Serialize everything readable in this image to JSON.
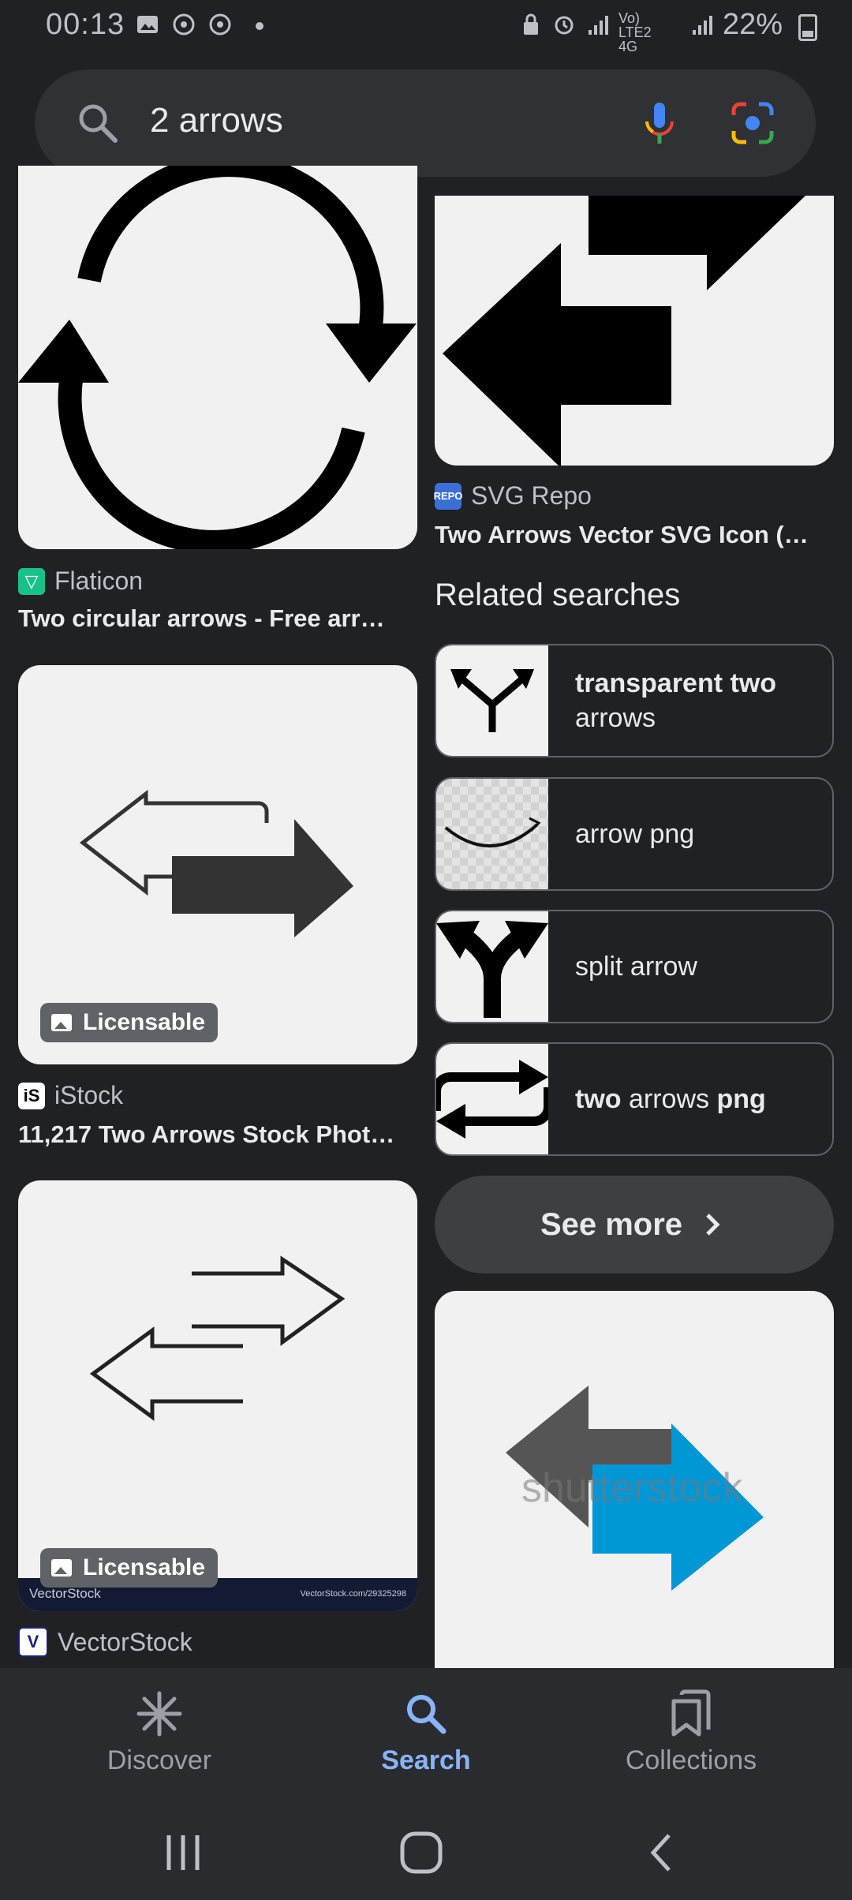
{
  "status_bar": {
    "time": "00:13",
    "battery": "22%",
    "signal_text": "Vo) LTE2 4G"
  },
  "search": {
    "query": "2 arrows"
  },
  "results": {
    "left": [
      {
        "source": "Flaticon",
        "title": "Two circular arrows - Free arro..."
      },
      {
        "source": "iStock",
        "title": "11,217 Two Arrows Stock Photo...",
        "badge": "Licensable"
      },
      {
        "source": "VectorStock",
        "title": "",
        "badge": "Licensable",
        "watermark_left": "VectorStock",
        "watermark_right": "VectorStock.com/29325298"
      }
    ],
    "right": [
      {
        "source": "SVG Repo",
        "title": "Two Arrows Vector SVG Icon (2)...",
        "favicon_text": "REPO"
      },
      {
        "watermark": "shutterstock"
      }
    ]
  },
  "related": {
    "title": "Related searches",
    "items": [
      {
        "bold": "transparent two",
        "normal": "arrows",
        "thumb_icon": "fork-arrow-icon"
      },
      {
        "bold": "",
        "normal": "arrow png",
        "thumb_icon": "smile-arrow-icon"
      },
      {
        "bold": "",
        "normal": "split arrow",
        "thumb_icon": "split-arrow-icon"
      },
      {
        "pre": "two",
        "normal": "arrows",
        "post": "png",
        "thumb_icon": "repeat-arrows-icon"
      }
    ],
    "see_more": "See more"
  },
  "bottom_nav": {
    "items": [
      {
        "label": "Discover",
        "icon": "asterisk-icon"
      },
      {
        "label": "Search",
        "icon": "search-icon",
        "active": true
      },
      {
        "label": "Collections",
        "icon": "collections-icon"
      }
    ]
  },
  "colors": {
    "background": "#202124",
    "active": "#8ab4f8",
    "shutterstock_blue": "#0097d7"
  }
}
